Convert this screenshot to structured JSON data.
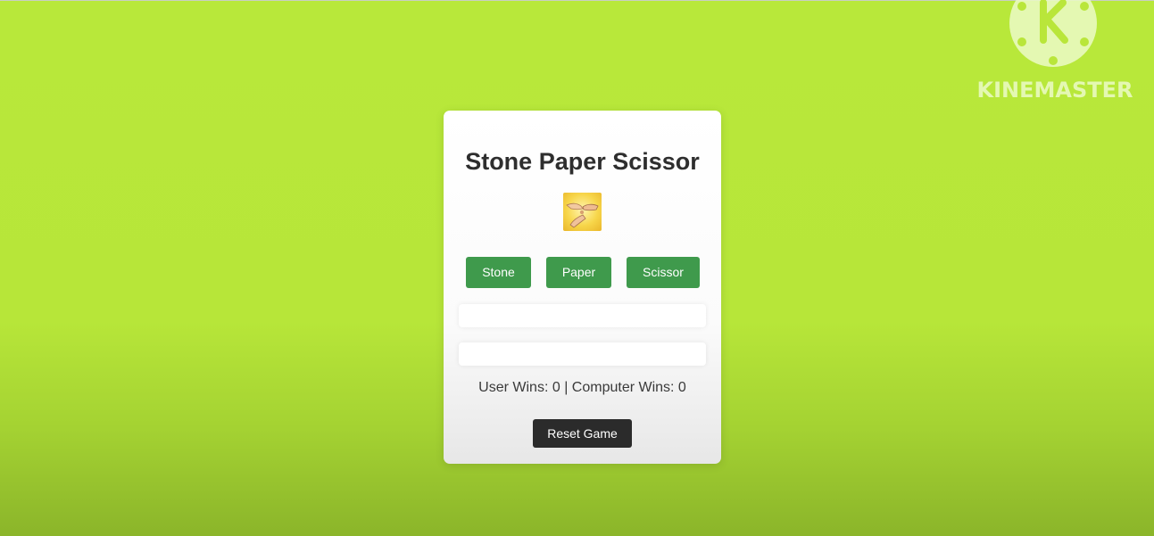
{
  "game": {
    "title": "Stone Paper Scissor",
    "image_icon": "hands-rock-paper-scissors-image",
    "choices": [
      {
        "label": "Stone"
      },
      {
        "label": "Paper"
      },
      {
        "label": "Scissor"
      }
    ],
    "result_text": "",
    "computer_choice_text": "",
    "score_text": "User Wins: 0 | Computer Wins: 0",
    "reset_label": "Reset Game"
  },
  "watermark": {
    "text": "KINEMASTER",
    "logo_letter": "K"
  },
  "colors": {
    "background": "#b8e83a",
    "choice_button": "#3f9a4c",
    "reset_button": "#2b2b2b",
    "title_text": "#2e2e2e"
  }
}
